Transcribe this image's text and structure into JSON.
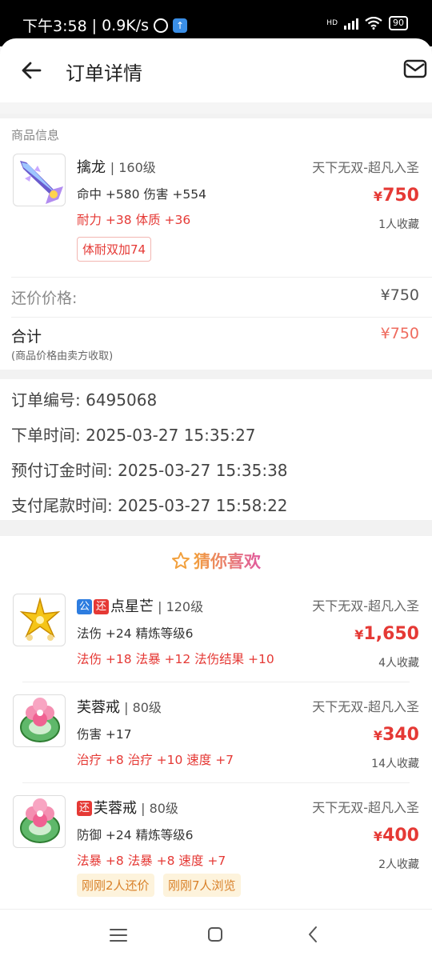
{
  "status_bar": {
    "time": "下午3:58",
    "speed": "0.9K/s",
    "battery": "90",
    "hd": "HD"
  },
  "header": {
    "title": "订单详情"
  },
  "product": {
    "section_label": "商品信息",
    "name": "擒龙",
    "level": "160级",
    "server": "天下无双-超凡入圣",
    "attr1": "命中 +580 伤害 +554",
    "attr2": "耐力 +38 体质 +36",
    "price": "750",
    "favorites": "1人收藏",
    "tag": "体耐双加74"
  },
  "pricing": {
    "counter_label": "还价价格:",
    "counter_value": "¥750",
    "total_label": "合计",
    "total_value": "¥750",
    "note": "(商品价格由卖方收取)"
  },
  "order": {
    "number_label": "订单编号:",
    "number": "6495068",
    "order_time_label": "下单时间:",
    "order_time": "2025-03-27 15:35:27",
    "deposit_time_label": "预付订金时间:",
    "deposit_time": "2025-03-27 15:35:38",
    "final_time_label": "支付尾款时间:",
    "final_time": "2025-03-27 15:58:22"
  },
  "guess": {
    "title": "猜你喜欢",
    "items": [
      {
        "badge_public": "公",
        "badge_bargain": "还",
        "name": "点星芒",
        "level": "120级",
        "server": "天下无双-超凡入圣",
        "attr1": "法伤 +24 精炼等级6",
        "attr2": "法伤 +18 法暴 +12 法伤结果 +10",
        "price": "1,650",
        "favorites": "4人收藏"
      },
      {
        "name": "芙蓉戒",
        "level": "80级",
        "server": "天下无双-超凡入圣",
        "attr1": "伤害 +17",
        "attr2": "治疗 +8 治疗 +10 速度 +7",
        "price": "340",
        "favorites": "14人收藏"
      },
      {
        "badge_bargain": "还",
        "name": "芙蓉戒",
        "level": "80级",
        "server": "天下无双-超凡入圣",
        "attr1": "防御 +24 精炼等级6",
        "attr2": "法暴 +8 法暴 +8 速度 +7",
        "price": "400",
        "favorites": "2人收藏",
        "tag1": "刚刚2人还价",
        "tag2": "刚刚7人浏览"
      }
    ]
  },
  "colors": {
    "price_red": "#e53935",
    "accent_orange": "#e8894a",
    "badge_blue": "#2d7de0"
  },
  "icons": [
    "back-arrow-icon",
    "mail-icon",
    "star-outline-icon",
    "menu-icon",
    "home-icon",
    "back-nav-icon",
    "wifi-icon",
    "signal-icon",
    "alarm-icon"
  ]
}
